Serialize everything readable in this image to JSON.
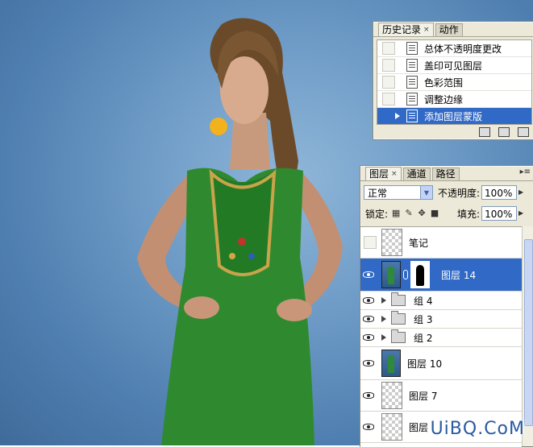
{
  "history_panel": {
    "tabs": [
      {
        "label": "历史记录",
        "close": "×"
      },
      {
        "label": "动作"
      }
    ],
    "items": [
      {
        "label": "总体不透明度更改",
        "selected": false
      },
      {
        "label": "盖印可见图层",
        "selected": false
      },
      {
        "label": "色彩范围",
        "selected": false
      },
      {
        "label": "调整边缘",
        "selected": false
      },
      {
        "label": "添加图层蒙版",
        "selected": true
      }
    ]
  },
  "layers_panel": {
    "tabs": [
      {
        "label": "图层",
        "close": "×"
      },
      {
        "label": "通道"
      },
      {
        "label": "路径"
      }
    ],
    "blend_mode": "正常",
    "opacity_label": "不透明度:",
    "opacity_value": "100%",
    "lock_label": "锁定:",
    "fill_label": "填充:",
    "fill_value": "100%",
    "layers": [
      {
        "name": "笔记",
        "type": "transparent",
        "visible": false,
        "selected": false
      },
      {
        "name": "图层 14",
        "type": "masked-photo",
        "visible": true,
        "selected": true
      },
      {
        "name": "组 4",
        "type": "group",
        "visible": true,
        "selected": false
      },
      {
        "name": "组 3",
        "type": "group",
        "visible": true,
        "selected": false
      },
      {
        "name": "组 2",
        "type": "group",
        "visible": true,
        "selected": false
      },
      {
        "name": "图层 10",
        "type": "photo",
        "visible": true,
        "selected": false
      },
      {
        "name": "图层 7",
        "type": "transparent",
        "visible": true,
        "selected": false
      },
      {
        "name": "图层",
        "type": "transparent",
        "visible": true,
        "selected": false
      }
    ]
  },
  "watermark": "UiBQ.CoM",
  "colors": {
    "selection": "#3169c6",
    "panel_bg": "#ece9d8",
    "canvas_bg": "#5f8fbf",
    "dress": "#2f8a2f"
  }
}
